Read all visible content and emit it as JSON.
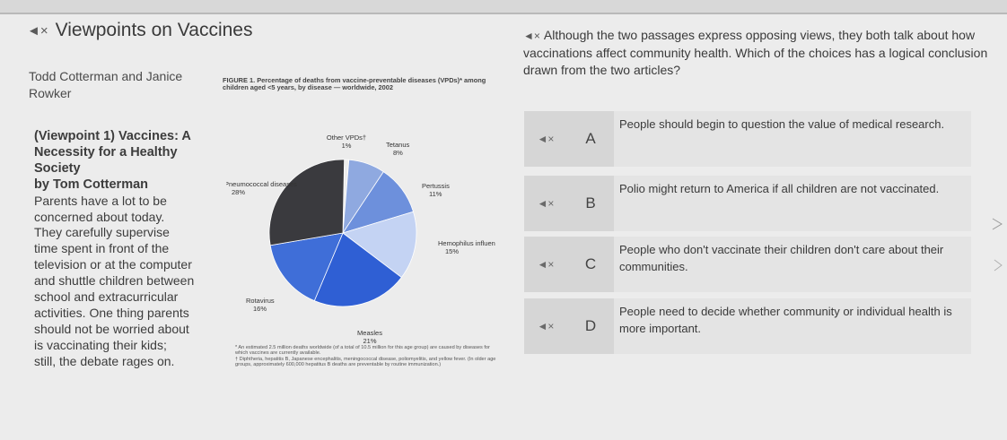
{
  "header": {
    "title": "Viewpoints on Vaccines"
  },
  "authors": "Todd Cotterman and Janice Rowker",
  "essay": {
    "heading": "(Viewpoint 1) Vaccines: A Necessity for a Healthy Society",
    "byline": "by Tom Cotterman",
    "lines": [
      "Parents have a lot to be",
      "concerned about today.",
      "They carefully supervise",
      "time spent in front of the",
      "television or at the computer",
      "and shuttle children between",
      "school and extracurricular",
      "activities. One thing parents",
      "should not be worried about",
      "is vaccinating their kids;",
      "still, the debate rages on."
    ]
  },
  "figure": {
    "caption": "FIGURE 1. Percentage of deaths from vaccine-preventable diseases (VPDs)* among children aged <5 years, by disease — worldwide, 2002",
    "footnote_1": "* An estimated 2.5 million deaths worldwide (of a total of 10.5 million for this age group) are caused by diseases for which vaccines are currently available.",
    "footnote_2": "† Diphtheria, hepatitis B, Japanese encephalitis, meningococcal disease, poliomyelitis, and yellow fever. (In older age groups, approximately 600,000 hepatitus B deaths are preventable by routine immunization.)"
  },
  "chart_data": {
    "type": "pie",
    "title": "FIGURE 1. Percentage of deaths from vaccine-preventable diseases (VPDs)* among children aged <5 years, by disease — worldwide, 2002",
    "slices": [
      {
        "label": "Other VPDs†",
        "value": 1,
        "color": "#eeeeee"
      },
      {
        "label": "Tetanus",
        "value": 8,
        "color": "#8fa9e0"
      },
      {
        "label": "Pertussis",
        "value": 11,
        "color": "#6d90dc"
      },
      {
        "label": "Hemophilus influenzae type B",
        "value": 15,
        "color": "#c4d3f3"
      },
      {
        "label": "Measles",
        "value": 21,
        "color": "#2f5fd4"
      },
      {
        "label": "Rotavirus",
        "value": 16,
        "color": "#3f6ed8"
      },
      {
        "label": "Pneumococcal diseases",
        "value": 28,
        "color": "#3a3a3e"
      }
    ],
    "value_labels": [
      "1%",
      "8%",
      "11%",
      "15%",
      "21%",
      "16%",
      "28%"
    ]
  },
  "question": {
    "text": "Although the two passages express opposing views, they both talk about how vaccinations affect community health. Which of the choices has a logical conclusion drawn from the two articles?"
  },
  "choices": [
    {
      "letter": "A",
      "text": "People should begin to question the value of medical research."
    },
    {
      "letter": "B",
      "text": "Polio might return to America if all children are not vaccinated."
    },
    {
      "letter": "C",
      "text": "People who don't vaccinate their children don't care about their communities."
    },
    {
      "letter": "D",
      "text": "People need to decide whether community or individual health is more important."
    }
  ],
  "icons": {
    "speaker": "speaker-icon"
  }
}
